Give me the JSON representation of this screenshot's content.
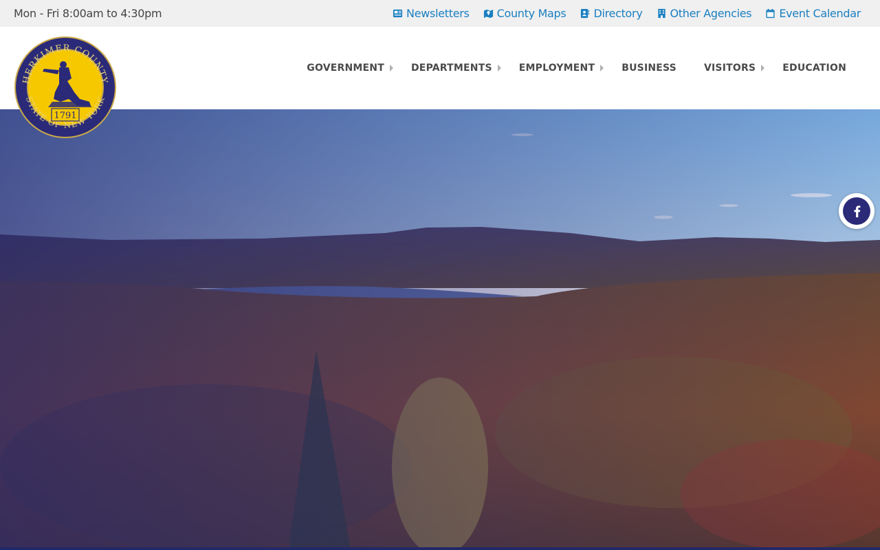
{
  "topbar": {
    "hours": "Mon - Fri 8:00am to 4:30pm",
    "links": [
      {
        "label": "Newsletters",
        "icon": "newspaper-icon"
      },
      {
        "label": "County Maps",
        "icon": "map-icon"
      },
      {
        "label": "Directory",
        "icon": "address-book-icon"
      },
      {
        "label": "Other Agencies",
        "icon": "building-icon"
      },
      {
        "label": "Event Calendar",
        "icon": "calendar-icon"
      }
    ],
    "link_color": "#1a7fc1"
  },
  "nav": {
    "items": [
      {
        "label": "GOVERNMENT",
        "has_submenu": true
      },
      {
        "label": "DEPARTMENTS",
        "has_submenu": true
      },
      {
        "label": "EMPLOYMENT",
        "has_submenu": true
      },
      {
        "label": "BUSINESS",
        "has_submenu": false
      },
      {
        "label": "VISITORS",
        "has_submenu": true
      },
      {
        "label": "EDUCATION",
        "has_submenu": false
      }
    ]
  },
  "seal": {
    "top_text": "HERKIMER COUNTY",
    "bottom_text": "STATE OF NEW YORK",
    "year": "1791",
    "colors": {
      "ring": "#2b2a78",
      "fill": "#f6c800"
    }
  },
  "social": {
    "facebook_icon": "facebook-icon",
    "color": "#2b2a78"
  }
}
